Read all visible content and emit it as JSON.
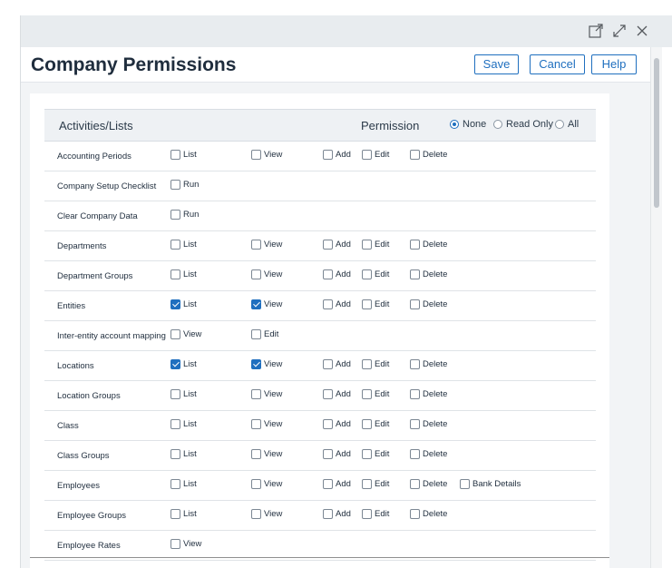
{
  "window": {
    "controls": [
      "open-in-new-window-icon",
      "expand-icon",
      "close-icon"
    ]
  },
  "header": {
    "title": "Company Permissions",
    "save_label": "Save",
    "cancel_label": "Cancel",
    "help_label": "Help"
  },
  "table": {
    "col_header": "Activities/Lists",
    "permission_label": "Permission",
    "permission_options": [
      {
        "label": "None",
        "selected": true
      },
      {
        "label": "Read Only",
        "selected": false
      },
      {
        "label": "All",
        "selected": false
      }
    ],
    "rows": [
      {
        "name": "Accounting Periods",
        "perms": [
          {
            "label": "List",
            "checked": false
          },
          {
            "label": "View",
            "checked": false
          },
          {
            "label": "Add",
            "checked": false
          },
          {
            "label": "Edit",
            "checked": false
          },
          {
            "label": "Delete",
            "checked": false
          }
        ]
      },
      {
        "name": "Company Setup Checklist",
        "perms": [
          {
            "label": "Run",
            "checked": false
          }
        ]
      },
      {
        "name": "Clear Company Data",
        "perms": [
          {
            "label": "Run",
            "checked": false
          }
        ]
      },
      {
        "name": "Departments",
        "perms": [
          {
            "label": "List",
            "checked": false
          },
          {
            "label": "View",
            "checked": false
          },
          {
            "label": "Add",
            "checked": false
          },
          {
            "label": "Edit",
            "checked": false
          },
          {
            "label": "Delete",
            "checked": false
          }
        ]
      },
      {
        "name": "Department Groups",
        "perms": [
          {
            "label": "List",
            "checked": false
          },
          {
            "label": "View",
            "checked": false
          },
          {
            "label": "Add",
            "checked": false
          },
          {
            "label": "Edit",
            "checked": false
          },
          {
            "label": "Delete",
            "checked": false
          }
        ]
      },
      {
        "name": "Entities",
        "perms": [
          {
            "label": "List",
            "checked": true
          },
          {
            "label": "View",
            "checked": true
          },
          {
            "label": "Add",
            "checked": false
          },
          {
            "label": "Edit",
            "checked": false
          },
          {
            "label": "Delete",
            "checked": false
          }
        ]
      },
      {
        "name": "Inter-entity account mapping",
        "perms": [
          {
            "label": "View",
            "checked": false
          },
          {
            "label": "Edit",
            "checked": false
          }
        ]
      },
      {
        "name": "Locations",
        "perms": [
          {
            "label": "List",
            "checked": true
          },
          {
            "label": "View",
            "checked": true
          },
          {
            "label": "Add",
            "checked": false
          },
          {
            "label": "Edit",
            "checked": false
          },
          {
            "label": "Delete",
            "checked": false
          }
        ]
      },
      {
        "name": "Location Groups",
        "perms": [
          {
            "label": "List",
            "checked": false
          },
          {
            "label": "View",
            "checked": false
          },
          {
            "label": "Add",
            "checked": false
          },
          {
            "label": "Edit",
            "checked": false
          },
          {
            "label": "Delete",
            "checked": false
          }
        ]
      },
      {
        "name": "Class",
        "perms": [
          {
            "label": "List",
            "checked": false
          },
          {
            "label": "View",
            "checked": false
          },
          {
            "label": "Add",
            "checked": false
          },
          {
            "label": "Edit",
            "checked": false
          },
          {
            "label": "Delete",
            "checked": false
          }
        ]
      },
      {
        "name": "Class Groups",
        "perms": [
          {
            "label": "List",
            "checked": false
          },
          {
            "label": "View",
            "checked": false
          },
          {
            "label": "Add",
            "checked": false
          },
          {
            "label": "Edit",
            "checked": false
          },
          {
            "label": "Delete",
            "checked": false
          }
        ]
      },
      {
        "name": "Employees",
        "perms": [
          {
            "label": "List",
            "checked": false
          },
          {
            "label": "View",
            "checked": false
          },
          {
            "label": "Add",
            "checked": false
          },
          {
            "label": "Edit",
            "checked": false
          },
          {
            "label": "Delete",
            "checked": false
          },
          {
            "label": "Bank Details",
            "checked": false
          }
        ]
      },
      {
        "name": "Employee Groups",
        "perms": [
          {
            "label": "List",
            "checked": false
          },
          {
            "label": "View",
            "checked": false
          },
          {
            "label": "Add",
            "checked": false
          },
          {
            "label": "Edit",
            "checked": false
          },
          {
            "label": "Delete",
            "checked": false
          }
        ]
      },
      {
        "name": "Employee Rates",
        "perms": [
          {
            "label": "View",
            "checked": false
          }
        ]
      }
    ]
  },
  "colors": {
    "accent": "#1f6fbf",
    "topbar": "#e8ecef",
    "content_bg": "#f2f4f6",
    "table_header_bg": "#eef1f4"
  }
}
